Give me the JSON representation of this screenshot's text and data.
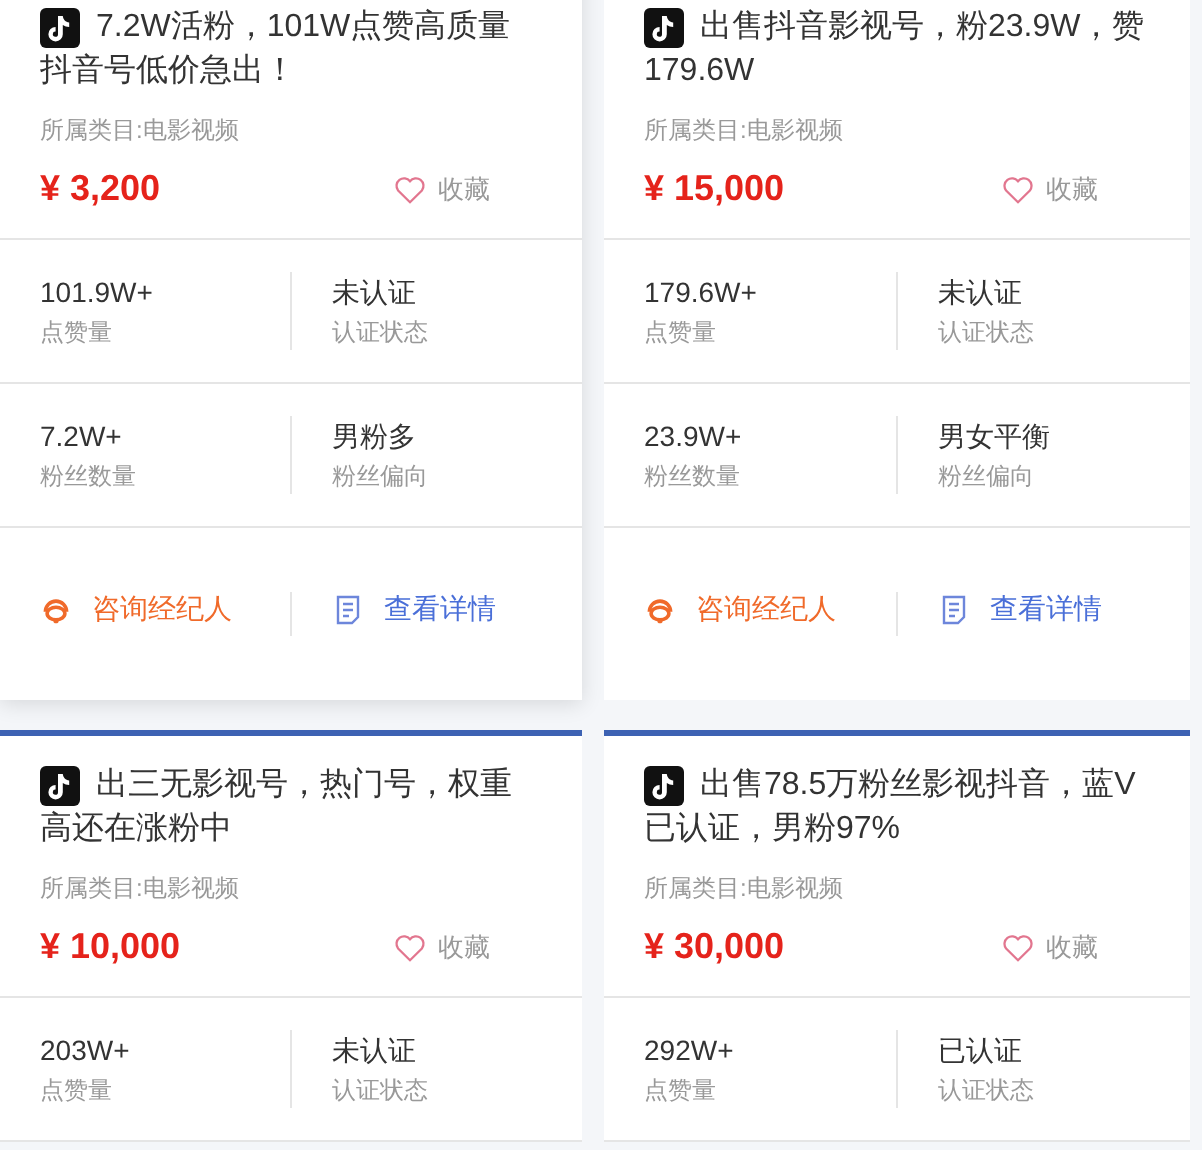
{
  "cards": [
    {
      "title": "7.2W活粉，101W点赞高质量抖音号低价急出！",
      "category": "所属类目:电影视频",
      "price": "¥ 3,200",
      "favorite": {
        "label": "收藏",
        "favorited": false
      },
      "hovered": true,
      "stats": [
        {
          "value": "101.9W+",
          "label": "点赞量"
        },
        {
          "value": "未认证",
          "label": "认证状态"
        },
        {
          "value": "7.2W+",
          "label": "粉丝数量"
        },
        {
          "value": "男粉多",
          "label": "粉丝偏向"
        }
      ],
      "actions": [
        {
          "kind": "consult",
          "label": "咨询经纪人"
        },
        {
          "kind": "details",
          "label": "查看详情"
        }
      ]
    },
    {
      "title": "出售抖音影视号，粉23.9W，赞179.6W",
      "category": "所属类目:电影视频",
      "price": "¥ 15,000",
      "favorite": {
        "label": "收藏",
        "favorited": false
      },
      "hovered": false,
      "stats": [
        {
          "value": "179.6W+",
          "label": "点赞量"
        },
        {
          "value": "未认证",
          "label": "认证状态"
        },
        {
          "value": "23.9W+",
          "label": "粉丝数量"
        },
        {
          "value": "男女平衡",
          "label": "粉丝偏向"
        }
      ],
      "actions": [
        {
          "kind": "consult",
          "label": "咨询经纪人"
        },
        {
          "kind": "details",
          "label": "查看详情"
        }
      ]
    },
    {
      "title": "出三无影视号，热门号，权重高还在涨粉中",
      "category": "所属类目:电影视频",
      "price": "¥ 10,000",
      "favorite": {
        "label": "收藏",
        "favorited": false
      },
      "hovered": false,
      "stats": [
        {
          "value": "203W+",
          "label": "点赞量"
        },
        {
          "value": "未认证",
          "label": "认证状态"
        }
      ]
    },
    {
      "title": "出售78.5万粉丝影视抖音，蓝V已认证，男粉97%",
      "category": "所属类目:电影视频",
      "price": "¥ 30,000",
      "favorite": {
        "label": "收藏",
        "favorited": false
      },
      "hovered": false,
      "stats": [
        {
          "value": "292W+",
          "label": "点赞量"
        },
        {
          "value": "已认证",
          "label": "认证状态"
        }
      ]
    }
  ]
}
